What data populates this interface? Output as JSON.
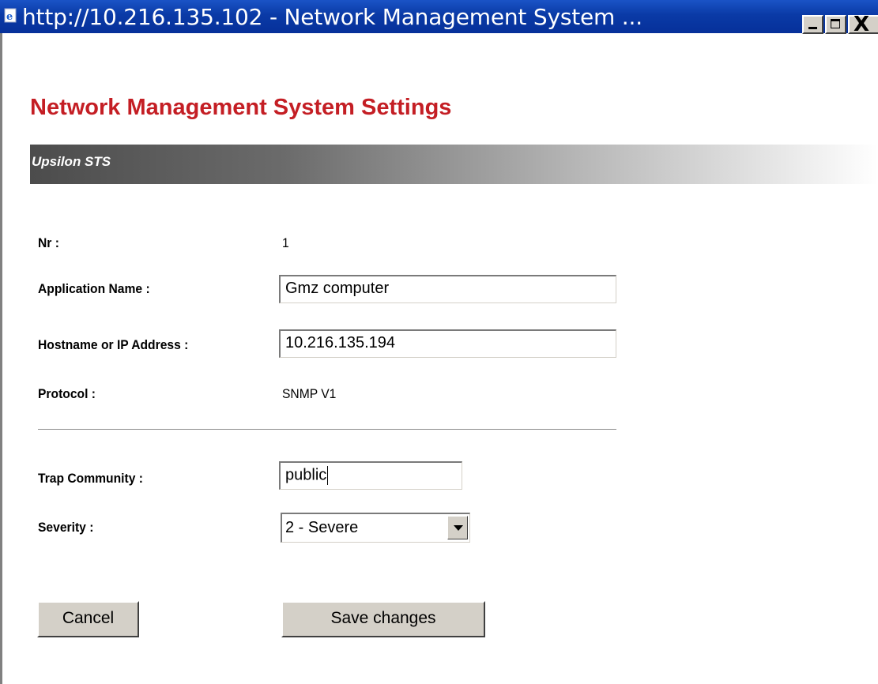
{
  "window": {
    "title": "http://10.216.135.102 - Network Management System ...",
    "controls": {
      "minimize": "minimize",
      "maximize": "maximize",
      "close": "X"
    }
  },
  "page": {
    "heading": "Network Management System Settings",
    "section": "Upsilon STS"
  },
  "form": {
    "nr": {
      "label": "Nr :",
      "value": "1"
    },
    "application_name": {
      "label": "Application Name :",
      "value": "Gmz computer"
    },
    "hostname": {
      "label": "Hostname or IP Address :",
      "value": "10.216.135.194"
    },
    "protocol": {
      "label": "Protocol :",
      "value": "SNMP V1"
    },
    "trap_community": {
      "label": "Trap Community :",
      "value": "public"
    },
    "severity": {
      "label": "Severity :",
      "value": "2 - Severe"
    }
  },
  "buttons": {
    "cancel": "Cancel",
    "save": "Save changes"
  },
  "colors": {
    "heading": "#c41e24",
    "titlebar": "#0a3aa6",
    "button_face": "#d4d0c8"
  },
  "icons": {
    "title_icon": "ie-page-icon",
    "dropdown": "chevron-down-icon"
  }
}
